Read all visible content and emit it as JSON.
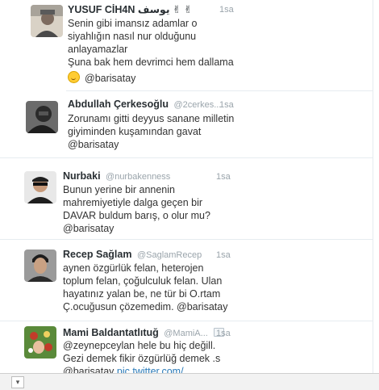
{
  "tweets": [
    {
      "name": "YUSUF CİH4N يوسف ✌ ✌",
      "handle": "",
      "time": "1sa",
      "lines": [
        "Senin gibi imansız adamlar o",
        "siyahlığın nasıl nur olduğunu",
        "anlayamazlar",
        "Şuna bak hem devrimci hem dallama",
        "@barisatay"
      ],
      "avatar_colors": [
        "#8d8d8d",
        "#d9d2c6"
      ]
    },
    {
      "name": "Abdullah Çerkesoğlu",
      "handle": "@2cerkes...",
      "time": "1sa",
      "lines": [
        "Zorunamı gitti deyyus sanane milletin",
        "giyiminden kuşamından gavat",
        "@barisatay"
      ],
      "avatar_colors": [
        "#2b2b2b",
        "#6b6b6b"
      ]
    },
    {
      "name": "Nurbaki",
      "handle": "@nurbakenness",
      "time": "1sa",
      "lines": [
        "Bunun yerine bir annenin",
        "mahremiyetiyle dalga geçen bir",
        "DAVAR buldum barış, o olur mu?",
        "@barisatay"
      ],
      "avatar_colors": [
        "#1f1f1f",
        "#c79a7a"
      ]
    },
    {
      "name": "Recep Sağlam",
      "handle": "@SaglamRecep",
      "time": "1sa",
      "lines": [
        "aynen özgürlük felan, heterojen",
        "toplum felan, çoğulculuk felan. Ulan",
        "hayatınız yalan be, ne tür bi O.rtam",
        "Ç.ocuğusun çözemedim. @barisatay"
      ],
      "avatar_colors": [
        "#3a3a3a",
        "#c9a183"
      ]
    },
    {
      "name": "Mami Baldantatlıtuğ",
      "handle": "@MamiA...",
      "time": "1sa",
      "lines": [
        "@zeynepceylan hele bu hiç değill.",
        "Gezi demek fikir özgürlüğ demek .s",
        "@barisatay pic.twitter.com/"
      ],
      "avatar_colors": [
        "#5a8a3a",
        "#c23b2a"
      ]
    }
  ]
}
